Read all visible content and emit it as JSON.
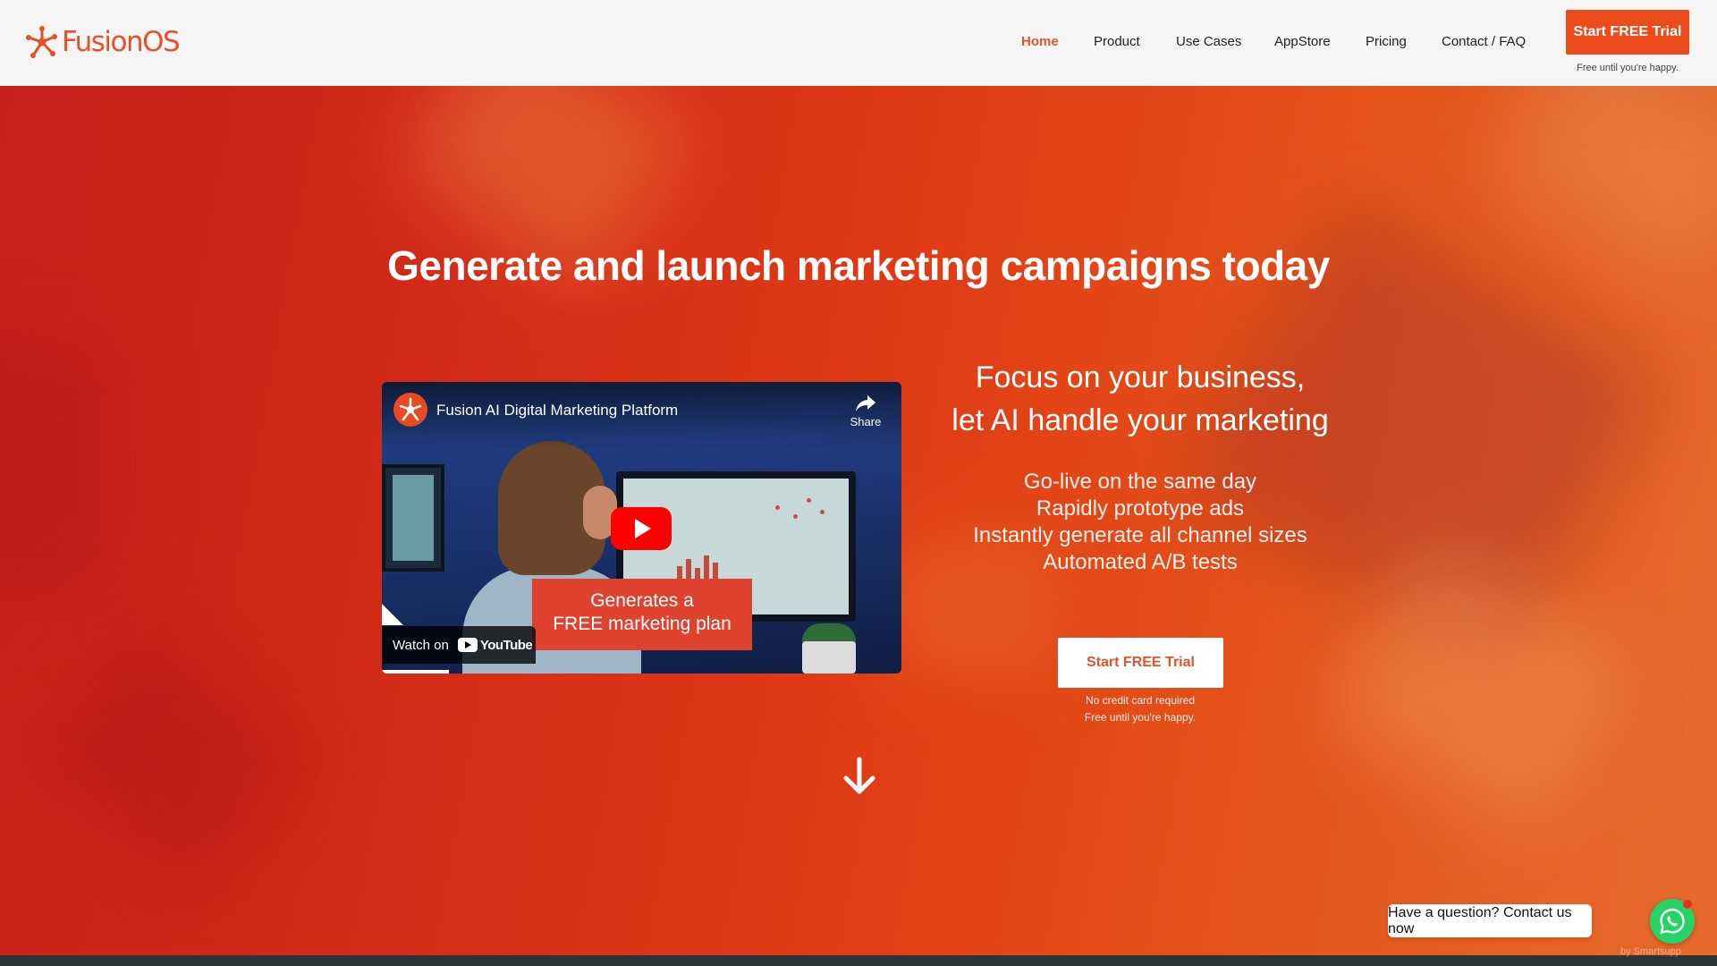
{
  "brand": {
    "name": "FusionOS",
    "accent": "#e5512a",
    "cta_color": "#ec4b1c"
  },
  "nav": {
    "items": [
      {
        "label": "Home",
        "active": true
      },
      {
        "label": "Product",
        "active": false
      },
      {
        "label": "Use Cases",
        "active": false
      },
      {
        "label": "AppStore",
        "active": false
      },
      {
        "label": "Pricing",
        "active": false
      },
      {
        "label": "Contact / FAQ",
        "active": false
      }
    ],
    "cta_label": "Start FREE Trial",
    "cta_subtext": "Free until you're happy."
  },
  "hero": {
    "title": "Generate and launch marketing campaigns today",
    "focus_line1": "Focus on your business,",
    "focus_line2": "let AI handle your marketing",
    "bullets": [
      "Go-live on the same day",
      "Rapidly prototype ads",
      "Instantly generate all channel sizes",
      "Automated A/B tests"
    ],
    "cta_label": "Start FREE Trial",
    "note_line1": "No credit card required",
    "note_line2": "Free until you're happy.",
    "scroll_icon": "arrow-down-icon"
  },
  "video": {
    "title": "Fusion AI Digital Marketing Platform",
    "share_label": "Share",
    "caption_line1": "Generates a",
    "caption_line2": "FREE marketing plan",
    "watch_on": "Watch on",
    "youtube_label": "YouTube",
    "play_icon": "play-icon"
  },
  "chat": {
    "prompt": "Have a question? Contact us now",
    "icon": "whatsapp-icon",
    "powered_by": "by Smartsupp"
  }
}
